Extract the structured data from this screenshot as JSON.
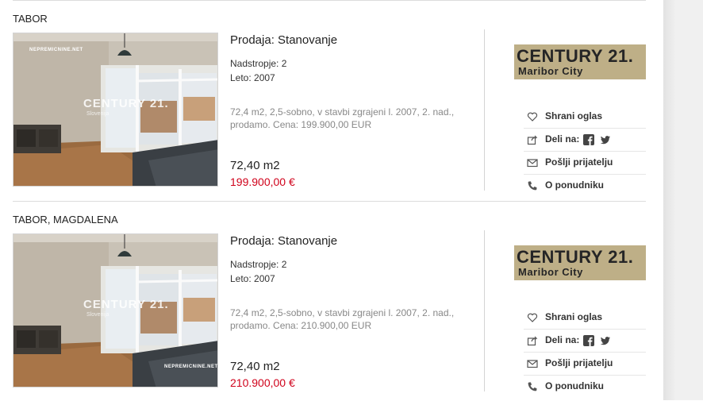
{
  "listings": [
    {
      "location": "TABOR",
      "title": "Prodaja: Stanovanje",
      "floor": "Nadstropje: 2",
      "year": "Leto: 2007",
      "description": "72,4 m2, 2,5-sobno, v stavbi zgrajeni l. 2007, 2. nad., prodamo. Cena: 199.900,00 EUR",
      "area": "72,40 m2",
      "price": "199.900,00 €",
      "photo_watermark_top": "NEPREMICNINE.NET",
      "photo_watermark_bottom": "",
      "photo_logo": "CENTURY 21.",
      "photo_logo_sub": "Slovenija",
      "agency_brand": "CENTURY 21.",
      "agency_office": "Maribor City",
      "actions": {
        "save": "Shrani oglas",
        "share": "Deli na:",
        "send": "Pošlji prijatelju",
        "provider": "O ponudniku"
      }
    },
    {
      "location": "TABOR, MAGDALENA",
      "title": "Prodaja: Stanovanje",
      "floor": "Nadstropje: 2",
      "year": "Leto: 2007",
      "description": "72,4 m2, 2,5-sobno, v stavbi zgrajeni l. 2007, 2. nad., prodamo. Cena: 210.900,00 EUR",
      "area": "72,40 m2",
      "price": "210.900,00 €",
      "photo_watermark_top": "",
      "photo_watermark_bottom": "NEPREMICNINE.NET",
      "photo_logo": "CENTURY 21.",
      "photo_logo_sub": "Slovenija",
      "agency_brand": "CENTURY 21.",
      "agency_office": "Maribor City",
      "actions": {
        "save": "Shrani oglas",
        "share": "Deli na:",
        "send": "Pošlji prijatelju",
        "provider": "O ponudniku"
      }
    }
  ],
  "colors": {
    "price": "#d0021b",
    "agency_bg": "#beaf87",
    "text": "#222222",
    "muted": "#888888"
  },
  "icons": [
    "heart-icon",
    "share-icon",
    "facebook-icon",
    "twitter-icon",
    "envelope-icon",
    "phone-icon"
  ]
}
